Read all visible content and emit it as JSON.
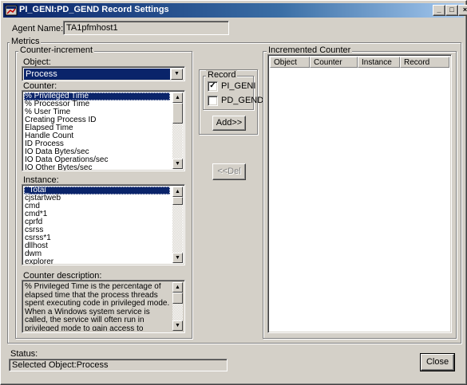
{
  "window": {
    "title": "PI_GENI:PD_GEND Record Settings",
    "minimize_glyph": "_",
    "restore_glyph": "□",
    "close_glyph": "×"
  },
  "agent": {
    "label": "Agent Name:",
    "value": "TA1pfmhost1"
  },
  "metrics": {
    "legend": "Metrics",
    "counter_increment": {
      "legend": "Counter-increment",
      "object_label": "Object:",
      "object_value": "Process",
      "counter_label": "Counter:",
      "counters": [
        "% Privileged Time",
        "% Processor Time",
        "% User Time",
        "Creating Process ID",
        "Elapsed Time",
        "Handle Count",
        "ID Process",
        "IO Data Bytes/sec",
        "IO Data Operations/sec",
        "IO Other Bytes/sec"
      ],
      "instance_label": "Instance:",
      "instances": [
        "_Total",
        "cjstartweb",
        "cmd",
        "cmd*1",
        "cprfd",
        "csrss",
        "csrss*1",
        "dllhost",
        "dwm",
        "explorer"
      ],
      "description_label": "Counter description:",
      "description": "% Privileged Time is the percentage of elapsed time that the process threads spent executing code in privileged mode. When a Windows system service is called, the service will often run in privileged mode to gain access to system-private data. Such data is protected from access by threads executing"
    },
    "record": {
      "legend": "Record",
      "options": [
        {
          "label": "PI_GENI",
          "checked": "✓"
        },
        {
          "label": "PD_GEND",
          "checked": ""
        }
      ],
      "add_button": "Add>>",
      "del_button": "<<Del"
    },
    "incremented_counter": {
      "legend": "Incremented Counter",
      "columns": [
        "Object",
        "Counter",
        "Instance",
        "Record"
      ]
    }
  },
  "status": {
    "label": "Status:",
    "value": "Selected Object:Process"
  },
  "close_button": "Close",
  "icons": {
    "app": "window-app-icon",
    "dropdown": "chevron-down-icon",
    "scroll_up": "scroll-up-icon",
    "scroll_down": "scroll-down-icon"
  },
  "colors": {
    "title_active": "#0a246a",
    "selection": "#0a246a",
    "face": "#d4d0c8"
  }
}
